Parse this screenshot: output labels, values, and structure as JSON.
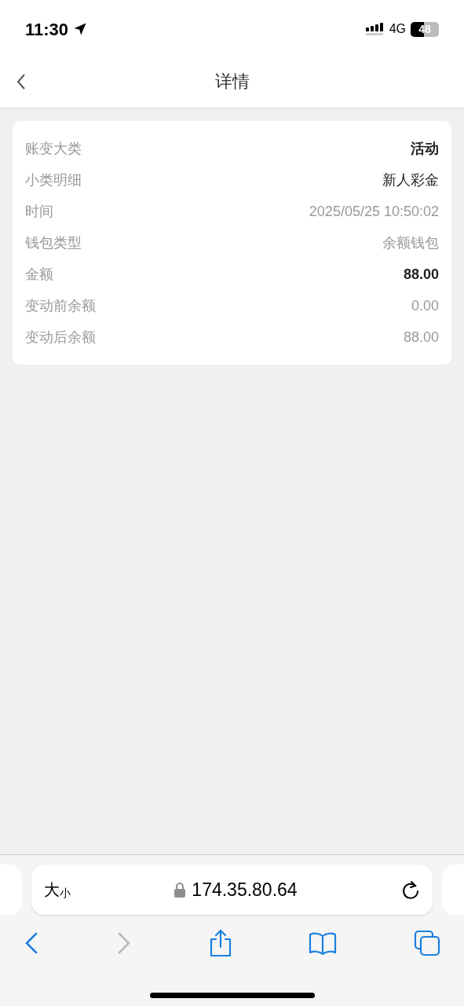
{
  "status_bar": {
    "time": "11:30",
    "network": "4G",
    "battery": "48"
  },
  "nav": {
    "title": "详情"
  },
  "details": [
    {
      "label": "账变大类",
      "value": "活动",
      "kind": "strong"
    },
    {
      "label": "小类明细",
      "value": "新人彩金",
      "kind": "normal"
    },
    {
      "label": "时间",
      "value": "2025/05/25 10:50:02",
      "kind": "muted"
    },
    {
      "label": "钱包类型",
      "value": "余额钱包",
      "kind": "muted"
    },
    {
      "label": "金额",
      "value": "88.00",
      "kind": "strong"
    },
    {
      "label": "变动前余额",
      "value": "0.00",
      "kind": "muted"
    },
    {
      "label": "变动后余额",
      "value": "88.00",
      "kind": "muted"
    }
  ],
  "browser": {
    "text_size_large": "大",
    "text_size_small": "小",
    "address": "174.35.80.64",
    "forward_disabled": true
  }
}
